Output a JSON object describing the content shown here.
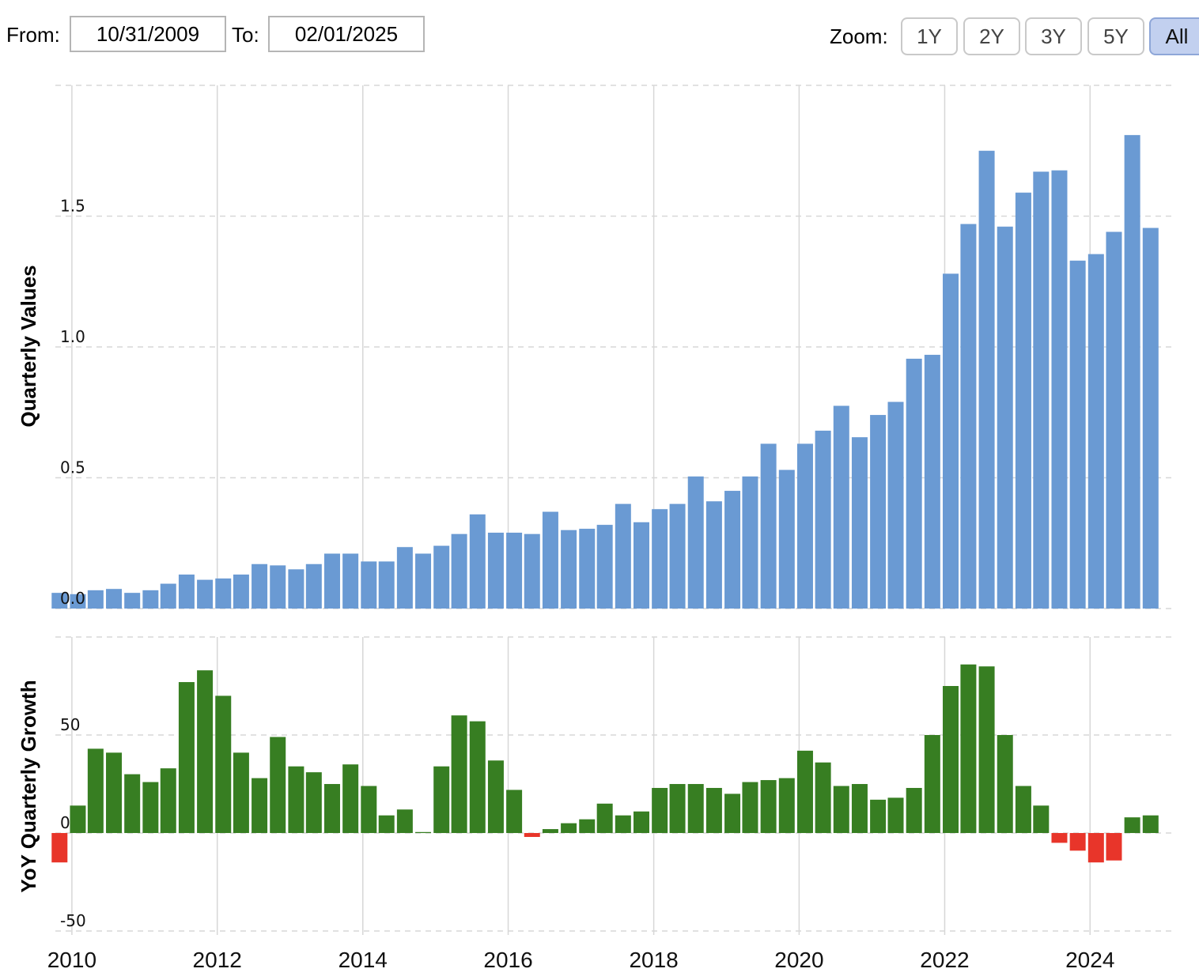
{
  "toolbar": {
    "from_label": "From:",
    "from_value": "10/31/2009",
    "to_label": "To:",
    "to_value": "02/01/2025",
    "zoom_label": "Zoom:",
    "zoom_buttons": [
      {
        "label": "1Y",
        "active": false
      },
      {
        "label": "2Y",
        "active": false
      },
      {
        "label": "3Y",
        "active": false
      },
      {
        "label": "5Y",
        "active": false
      },
      {
        "label": "All",
        "active": true
      }
    ]
  },
  "colors": {
    "value_bar": "#6a9ad3",
    "growth_positive": "#377e22",
    "growth_negative": "#e8352a",
    "gridline": "#d7d7d7"
  },
  "chart_data": [
    {
      "type": "bar",
      "ylabel": "Quarterly Values",
      "ylim": [
        0,
        2.0
      ],
      "yticks": [
        {
          "value": 0.0,
          "label": "0.0"
        },
        {
          "value": 0.5,
          "label": "0.5"
        },
        {
          "value": 1.0,
          "label": "1.0"
        },
        {
          "value": 1.5,
          "label": "1.5"
        }
      ],
      "grid": true,
      "x": [
        "2009-10-31",
        "2010-01-31",
        "2010-04-30",
        "2010-07-31",
        "2010-10-31",
        "2011-01-31",
        "2011-04-30",
        "2011-07-31",
        "2011-10-31",
        "2012-01-31",
        "2012-04-30",
        "2012-07-31",
        "2012-10-31",
        "2013-01-31",
        "2013-04-30",
        "2013-07-31",
        "2013-10-31",
        "2014-01-31",
        "2014-04-30",
        "2014-07-31",
        "2014-10-31",
        "2015-01-31",
        "2015-04-30",
        "2015-07-31",
        "2015-10-31",
        "2016-01-31",
        "2016-04-30",
        "2016-07-31",
        "2016-10-31",
        "2017-01-31",
        "2017-04-30",
        "2017-07-31",
        "2017-10-31",
        "2018-01-31",
        "2018-04-30",
        "2018-07-31",
        "2018-10-31",
        "2019-01-31",
        "2019-04-30",
        "2019-07-31",
        "2019-10-31",
        "2020-01-31",
        "2020-04-30",
        "2020-07-31",
        "2020-10-31",
        "2021-01-31",
        "2021-04-30",
        "2021-07-31",
        "2021-10-31",
        "2022-01-31",
        "2022-04-30",
        "2022-07-31",
        "2022-10-31",
        "2023-01-31",
        "2023-04-30",
        "2023-07-31",
        "2023-10-31",
        "2024-01-31",
        "2024-04-30",
        "2024-07-31",
        "2024-10-31",
        "2025-01-31"
      ],
      "values": [
        0.06,
        0.055,
        0.07,
        0.075,
        0.06,
        0.07,
        0.095,
        0.13,
        0.11,
        0.115,
        0.13,
        0.17,
        0.165,
        0.15,
        0.17,
        0.21,
        0.21,
        0.18,
        0.18,
        0.235,
        0.21,
        0.24,
        0.285,
        0.36,
        0.29,
        0.29,
        0.285,
        0.37,
        0.3,
        0.305,
        0.32,
        0.4,
        0.33,
        0.38,
        0.4,
        0.505,
        0.41,
        0.45,
        0.505,
        0.63,
        0.53,
        0.63,
        0.68,
        0.775,
        0.655,
        0.74,
        0.79,
        0.955,
        0.97,
        1.28,
        1.47,
        1.75,
        1.46,
        1.59,
        1.67,
        1.675,
        1.33,
        1.355,
        1.44,
        1.81,
        1.455
      ]
    },
    {
      "type": "bar",
      "ylabel": "YoY Quarterly Growth",
      "ylim": [
        -52,
        100
      ],
      "yticks": [
        {
          "value": -50,
          "label": "-50"
        },
        {
          "value": 0,
          "label": "0"
        },
        {
          "value": 50,
          "label": "50"
        }
      ],
      "grid": true,
      "x": [
        "2009-10-31",
        "2010-01-31",
        "2010-04-30",
        "2010-07-31",
        "2010-10-31",
        "2011-01-31",
        "2011-04-30",
        "2011-07-31",
        "2011-10-31",
        "2012-01-31",
        "2012-04-30",
        "2012-07-31",
        "2012-10-31",
        "2013-01-31",
        "2013-04-30",
        "2013-07-31",
        "2013-10-31",
        "2014-01-31",
        "2014-04-30",
        "2014-07-31",
        "2014-10-31",
        "2015-01-31",
        "2015-04-30",
        "2015-07-31",
        "2015-10-31",
        "2016-01-31",
        "2016-04-30",
        "2016-07-31",
        "2016-10-31",
        "2017-01-31",
        "2017-04-30",
        "2017-07-31",
        "2017-10-31",
        "2018-01-31",
        "2018-04-30",
        "2018-07-31",
        "2018-10-31",
        "2019-01-31",
        "2019-04-30",
        "2019-07-31",
        "2019-10-31",
        "2020-01-31",
        "2020-04-30",
        "2020-07-31",
        "2020-10-31",
        "2021-01-31",
        "2021-04-30",
        "2021-07-31",
        "2021-10-31",
        "2022-01-31",
        "2022-04-30",
        "2022-07-31",
        "2022-10-31",
        "2023-01-31",
        "2023-04-30",
        "2023-07-31",
        "2023-10-31",
        "2024-01-31",
        "2024-04-30",
        "2024-07-31",
        "2024-10-31",
        "2025-01-31"
      ],
      "values": [
        -15,
        14,
        43,
        41,
        30,
        26,
        33,
        77,
        83,
        70,
        41,
        28,
        49,
        34,
        31,
        25,
        35,
        24,
        9,
        12,
        0.5,
        34,
        60,
        57,
        37,
        22,
        -2,
        2,
        5,
        7,
        15,
        9,
        11,
        23,
        25,
        25,
        23,
        20,
        26,
        27,
        28,
        42,
        36,
        24,
        25,
        17,
        18,
        23,
        50,
        75,
        86,
        85,
        50,
        24,
        14,
        -5,
        -9,
        -15,
        -14,
        8,
        9
      ]
    }
  ],
  "x_axis": {
    "ticks": [
      "2010",
      "2012",
      "2014",
      "2016",
      "2018",
      "2020",
      "2022",
      "2024"
    ]
  }
}
